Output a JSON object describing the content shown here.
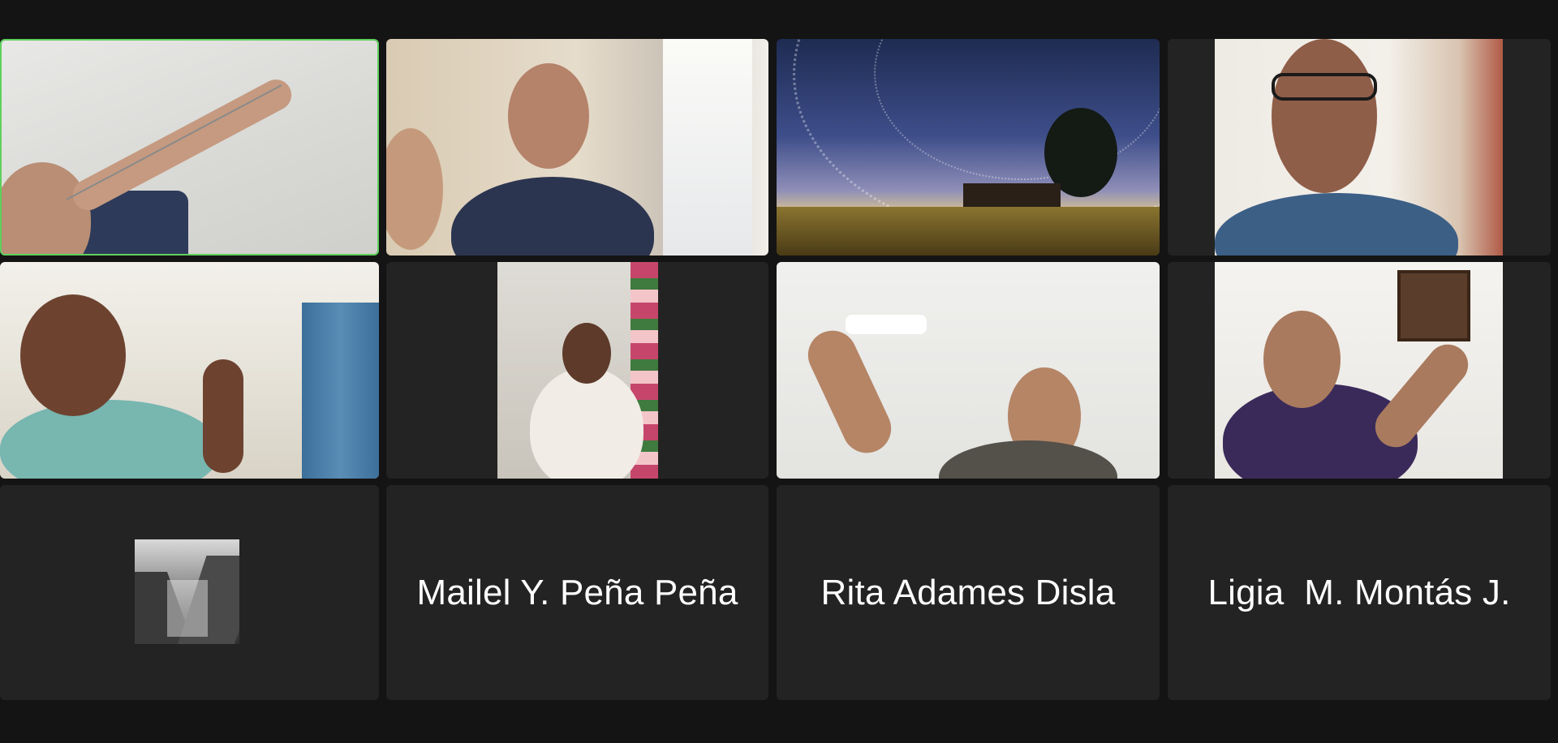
{
  "meeting": {
    "view": "gallery",
    "participants": [
      {
        "id": "p1",
        "scene": "woman-holding-paper-on-string",
        "active_speaker": true
      },
      {
        "id": "p2",
        "scene": "woman-and-child-smiling"
      },
      {
        "id": "p3",
        "scene": "star-trails-over-house"
      },
      {
        "id": "p4",
        "scene": "woman-with-glasses"
      },
      {
        "id": "p5",
        "scene": "man-holding-string"
      },
      {
        "id": "p6",
        "scene": "woman-in-floral-dress"
      },
      {
        "id": "p7",
        "scene": "woman-holding-paper-strip"
      },
      {
        "id": "p8",
        "scene": "woman-with-glasses-holding-string"
      },
      {
        "id": "p9",
        "scene": "profile-picture-mountain-valley"
      },
      {
        "id": "p10",
        "name": "Mailel Y. Peña Peña"
      },
      {
        "id": "p11",
        "name": "Rita Adames Disla"
      },
      {
        "id": "p12",
        "name": "Ligia  M. Montás J."
      }
    ]
  },
  "colors": {
    "background": "#141414",
    "tile": "#232323",
    "active_speaker_border": "#5fd05c",
    "name_text": "#ffffff"
  }
}
